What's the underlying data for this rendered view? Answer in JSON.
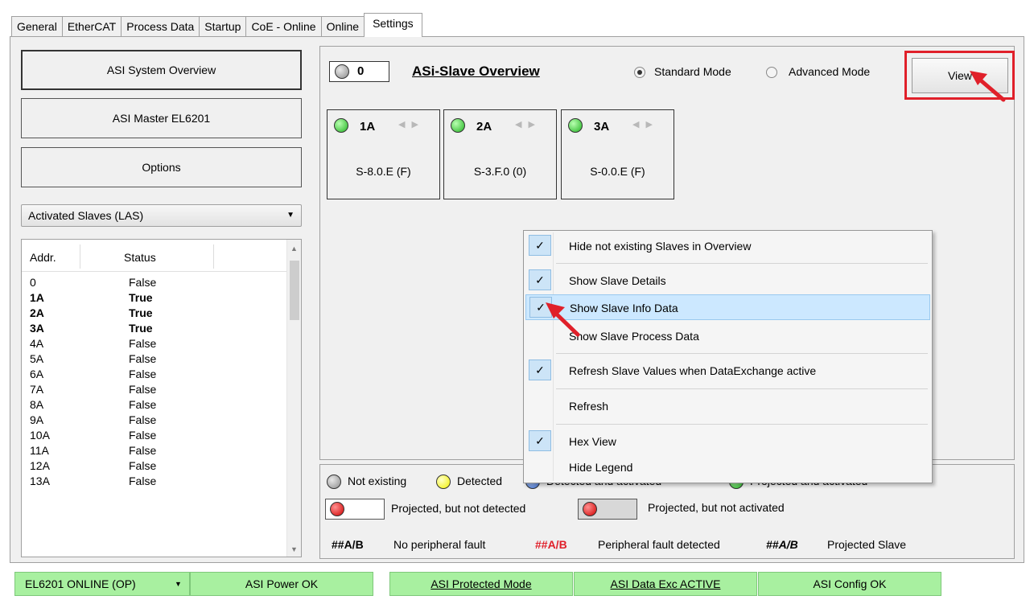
{
  "tabs": [
    "General",
    "EtherCAT",
    "Process Data",
    "Startup",
    "CoE - Online",
    "Online",
    "Settings"
  ],
  "active_tab": "Settings",
  "left": {
    "buttons": [
      "ASI System Overview",
      "ASI Master EL6201",
      "Options"
    ],
    "dropdown_value": "Activated Slaves (LAS)",
    "list_headers": [
      "Addr.",
      "Status"
    ],
    "rows": [
      {
        "addr": "0",
        "status": "False",
        "bold": false
      },
      {
        "addr": "1A",
        "status": "True",
        "bold": true
      },
      {
        "addr": "2A",
        "status": "True",
        "bold": true
      },
      {
        "addr": "3A",
        "status": "True",
        "bold": true
      },
      {
        "addr": "4A",
        "status": "False",
        "bold": false
      },
      {
        "addr": "5A",
        "status": "False",
        "bold": false
      },
      {
        "addr": "6A",
        "status": "False",
        "bold": false
      },
      {
        "addr": "7A",
        "status": "False",
        "bold": false
      },
      {
        "addr": "8A",
        "status": "False",
        "bold": false
      },
      {
        "addr": "9A",
        "status": "False",
        "bold": false
      },
      {
        "addr": "10A",
        "status": "False",
        "bold": false
      },
      {
        "addr": "11A",
        "status": "False",
        "bold": false
      },
      {
        "addr": "12A",
        "status": "False",
        "bold": false
      },
      {
        "addr": "13A",
        "status": "False",
        "bold": false
      }
    ]
  },
  "overview": {
    "master_addr": "0",
    "title": "ASi-Slave Overview",
    "mode_standard": "Standard Mode",
    "mode_advanced": "Advanced Mode",
    "selected_mode": "Standard Mode",
    "view_button": "View",
    "slaves": [
      {
        "addr": "1A",
        "code": "S-8.0.E (F)",
        "led": "green"
      },
      {
        "addr": "2A",
        "code": "S-3.F.0 (0)",
        "led": "green"
      },
      {
        "addr": "3A",
        "code": "S-0.0.E (F)",
        "led": "green"
      }
    ]
  },
  "legend": {
    "not_existing": "Not existing",
    "detected": "Detected",
    "detected_activated": "Detected and activated",
    "projected_activated": "Projected and activated",
    "projected_not_detected": "Projected, but not detected",
    "projected_not_activated": "Projected, but not activated",
    "hash": "##A/B",
    "no_fault": "No peripheral fault",
    "fault": "Peripheral fault detected",
    "projected_slave": "Projected Slave"
  },
  "menu": {
    "items": [
      {
        "label": "Hide not existing Slaves in Overview",
        "checked": true
      },
      {
        "label": "Show Slave Details",
        "checked": true
      },
      {
        "label": "Show Slave Info Data",
        "checked": true,
        "highlighted": true
      },
      {
        "label": "Show Slave Process Data",
        "checked": false
      },
      {
        "label": "Refresh Slave Values when DataExchange active",
        "checked": true
      },
      {
        "label": "Refresh",
        "checked": false
      },
      {
        "label": "Hex View",
        "checked": true
      },
      {
        "label": "Hide Legend",
        "checked": false
      }
    ]
  },
  "status": {
    "device": "EL6201 ONLINE (OP)",
    "power": "ASI Power OK",
    "protected": "ASI Protected Mode",
    "data_exc": "ASI Data Exc ACTIVE",
    "config": "ASI Config OK"
  },
  "colors": {
    "status_green": "#a8f0a0",
    "highlight_red": "#e0202a",
    "menu_highlight": "#cce8ff"
  }
}
